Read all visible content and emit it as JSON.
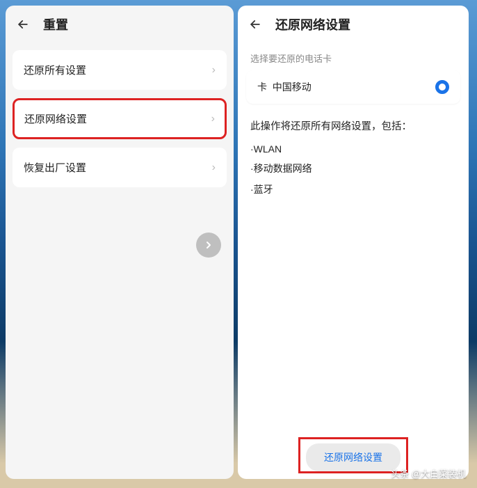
{
  "left": {
    "title": "重置",
    "items": [
      {
        "label": "还原所有设置"
      },
      {
        "label": "还原网络设置"
      },
      {
        "label": "恢复出厂设置"
      }
    ]
  },
  "right": {
    "title": "还原网络设置",
    "sim_hdr": "选择要还原的电话卡",
    "sim_prefix": "卡",
    "sim_name": "中国移动",
    "desc": "此操作将还原所有网络设置，包括：",
    "bullets": [
      "WLAN",
      "移动数据网络",
      "蓝牙"
    ],
    "button": "还原网络设置"
  },
  "watermark": "头条 @大白菜装机"
}
